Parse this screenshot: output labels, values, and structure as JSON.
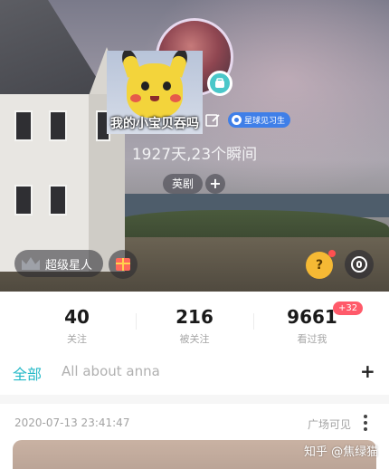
{
  "profile": {
    "sticker_caption": "我的小宝贝吞吗",
    "level_badge": "星球见习生",
    "subtitle": "1927天,23个瞬间",
    "tag": "英剧",
    "tag_add": "+"
  },
  "actions": {
    "vip_label": "超级星人",
    "mascot_glyph": "?"
  },
  "stats": [
    {
      "value": "40",
      "label": "关注"
    },
    {
      "value": "216",
      "label": "被关注"
    },
    {
      "value": "9661",
      "label": "看过我"
    }
  ],
  "stats_badge": "+32",
  "tabs": {
    "active": "全部",
    "second": "All about anna",
    "add": "+"
  },
  "post": {
    "time": "2020-07-13 23:41:47",
    "visibility": "广场可见"
  },
  "watermark": "知乎 @焦绿猫",
  "colors": {
    "accent": "#24b9c7",
    "badge_blue": "#3f7fe8",
    "new_badge": "#ff5a6a"
  },
  "icons": [
    "edit-icon",
    "crown-icon",
    "gift-icon",
    "mascot-icon",
    "voice-icon",
    "more-icon"
  ]
}
